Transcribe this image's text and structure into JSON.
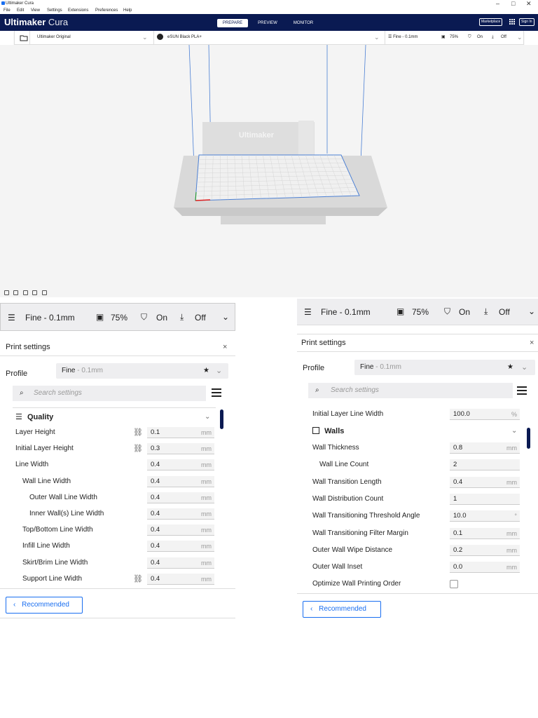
{
  "window": {
    "title": "Ultimaker Cura"
  },
  "menu": [
    "File",
    "Edit",
    "View",
    "Settings",
    "Extensions",
    "Preferences",
    "Help"
  ],
  "header": {
    "logo_bold": "Ultimaker",
    "logo_light": "Cura",
    "stages": [
      "PREPARE",
      "PREVIEW",
      "MONITOR"
    ],
    "marketplace": "Marketplace",
    "sign_in": "Sign In"
  },
  "toolbar": {
    "printer": "Ultimaker Original",
    "material": "eSUN Black PLA+",
    "profile": "Fine - 0.1mm",
    "infill": "75%",
    "support": "On",
    "adhesion": "Off"
  },
  "viewport": {
    "build_plate_logo": "Ultimaker"
  },
  "panel_left": {
    "bar": {
      "profile": "Fine - 0.1mm",
      "infill": "75%",
      "support": "On",
      "adhesion": "Off"
    },
    "title": "Print settings",
    "profile_label": "Profile",
    "profile_name": "Fine",
    "profile_sub": " - 0.1mm",
    "search_placeholder": "Search settings",
    "category": "Quality",
    "settings": [
      {
        "label": "Layer Height",
        "value": "0.1",
        "unit": "mm",
        "link": true,
        "indent": 0
      },
      {
        "label": "Initial Layer Height",
        "value": "0.3",
        "unit": "mm",
        "link": true,
        "indent": 0
      },
      {
        "label": "Line Width",
        "value": "0.4",
        "unit": "mm",
        "link": false,
        "indent": 0
      },
      {
        "label": "Wall Line Width",
        "value": "0.4",
        "unit": "mm",
        "link": false,
        "indent": 1
      },
      {
        "label": "Outer Wall Line Width",
        "value": "0.4",
        "unit": "mm",
        "link": false,
        "indent": 2
      },
      {
        "label": "Inner Wall(s) Line Width",
        "value": "0.4",
        "unit": "mm",
        "link": false,
        "indent": 2
      },
      {
        "label": "Top/Bottom Line Width",
        "value": "0.4",
        "unit": "mm",
        "link": false,
        "indent": 1
      },
      {
        "label": "Infill Line Width",
        "value": "0.4",
        "unit": "mm",
        "link": false,
        "indent": 1
      },
      {
        "label": "Skirt/Brim Line Width",
        "value": "0.4",
        "unit": "mm",
        "link": false,
        "indent": 1
      },
      {
        "label": "Support Line Width",
        "value": "0.4",
        "unit": "mm",
        "link": true,
        "indent": 1
      }
    ],
    "recommended": "Recommended"
  },
  "panel_right": {
    "bar": {
      "profile": "Fine - 0.1mm",
      "infill": "75%",
      "support": "On",
      "adhesion": "Off"
    },
    "title": "Print settings",
    "profile_label": "Profile",
    "profile_name": "Fine",
    "profile_sub": " - 0.1mm",
    "search_placeholder": "Search settings",
    "top_setting": {
      "label": "Initial Layer Line Width",
      "value": "100.0",
      "unit": "%"
    },
    "category": "Walls",
    "settings": [
      {
        "label": "Wall Thickness",
        "value": "0.8",
        "unit": "mm",
        "indent": 0,
        "kind": "input"
      },
      {
        "label": "Wall Line Count",
        "value": "2",
        "unit": "",
        "indent": 1,
        "kind": "input"
      },
      {
        "label": "Wall Transition Length",
        "value": "0.4",
        "unit": "mm",
        "indent": 0,
        "kind": "input"
      },
      {
        "label": "Wall Distribution Count",
        "value": "1",
        "unit": "",
        "indent": 0,
        "kind": "input"
      },
      {
        "label": "Wall Transitioning Threshold Angle",
        "value": "10.0",
        "unit": "°",
        "indent": 0,
        "kind": "input"
      },
      {
        "label": "Wall Transitioning Filter Margin",
        "value": "0.1",
        "unit": "mm",
        "indent": 0,
        "kind": "input"
      },
      {
        "label": "Outer Wall Wipe Distance",
        "value": "0.2",
        "unit": "mm",
        "indent": 0,
        "kind": "input"
      },
      {
        "label": "Outer Wall Inset",
        "value": "0.0",
        "unit": "mm",
        "indent": 0,
        "kind": "input"
      },
      {
        "label": "Optimize Wall Printing Order",
        "value": "",
        "unit": "",
        "indent": 0,
        "kind": "checkbox"
      }
    ],
    "recommended": "Recommended"
  },
  "icons": {
    "infill": "infill-icon",
    "support": "support-icon",
    "adhesion": "adhesion-icon",
    "profile": "sliders-icon",
    "link": "link-icon",
    "star": "star-icon"
  },
  "colors": {
    "header": "#0a1a52",
    "accent": "#196ef0",
    "plate_line": "#4a7fd4"
  }
}
